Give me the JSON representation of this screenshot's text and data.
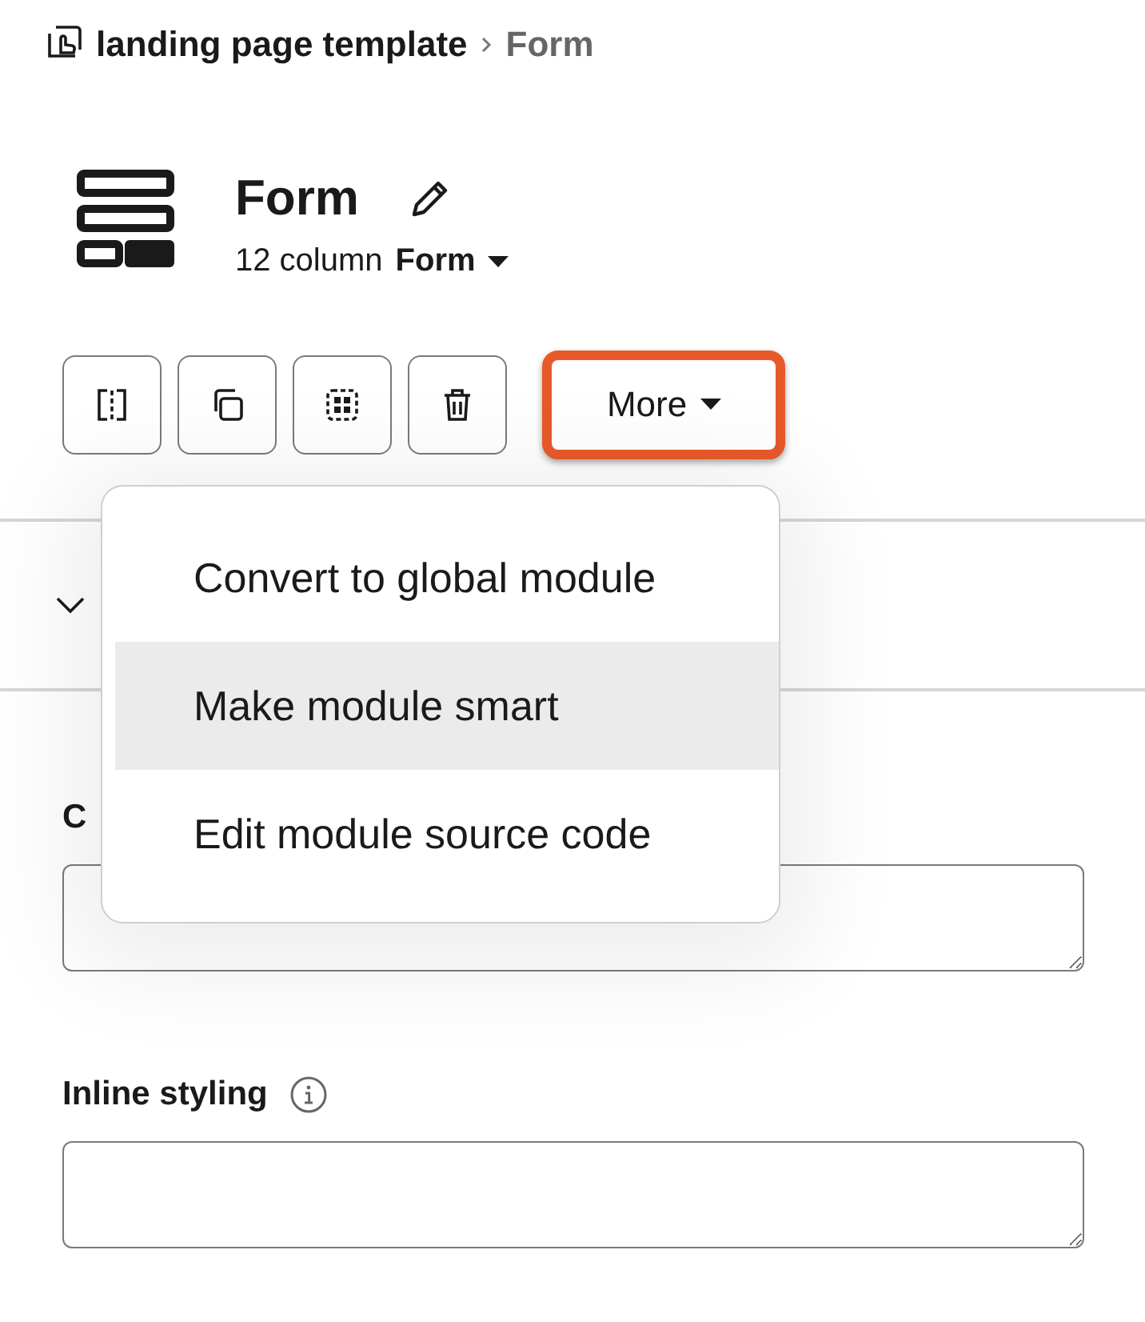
{
  "breadcrumb": {
    "items": [
      "landing page template",
      "Form"
    ]
  },
  "module": {
    "title": "Form",
    "subtitle_prefix": "12 column",
    "subtitle_value": "Form"
  },
  "toolbar": {
    "buttons": [
      {
        "kind": "split"
      },
      {
        "kind": "clone"
      },
      {
        "kind": "select"
      },
      {
        "kind": "delete"
      }
    ],
    "more": {
      "label": "More",
      "highlighted": true
    }
  },
  "menu": {
    "items": [
      {
        "label": "Convert to global module",
        "selected": false
      },
      {
        "label": "Make module smart",
        "selected": true
      },
      {
        "label": "Edit module source code",
        "selected": false
      }
    ]
  },
  "fields": [
    {
      "kind": "plain",
      "label": "C"
    },
    {
      "kind": "info",
      "label": "Inline styling"
    }
  ]
}
